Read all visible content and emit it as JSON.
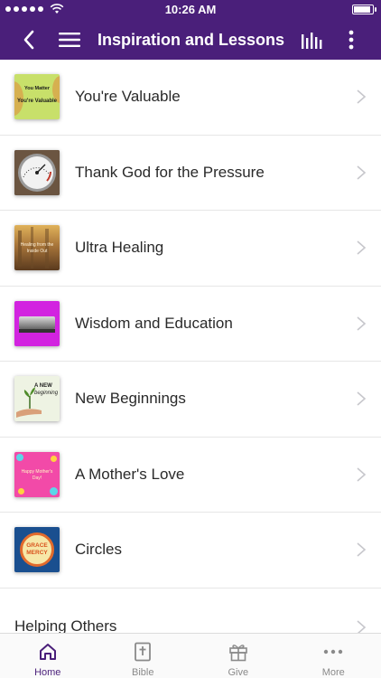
{
  "status": {
    "time": "10:26 AM",
    "battery_level": 0.95
  },
  "nav": {
    "title": "Inspiration and Lessons",
    "back_icon": "chevron-left-icon",
    "menu_icon": "hamburger-menu-icon",
    "audio_icon": "audio-bars-icon",
    "more_icon": "vertical-dots-icon"
  },
  "items": [
    {
      "title": "You're Valuable",
      "thumb_lines": [
        "You Matter",
        "You're Valuable"
      ]
    },
    {
      "title": "Thank God for the Pressure"
    },
    {
      "title": "Ultra Healing",
      "thumb_lines": [
        "Healing from the",
        "Inside Out"
      ]
    },
    {
      "title": "Wisdom and Education"
    },
    {
      "title": "New Beginnings",
      "thumb_lines": [
        "A NEW",
        "beginning"
      ]
    },
    {
      "title": "A Mother's Love",
      "thumb_lines": [
        "Happy Mother's",
        "Day!"
      ]
    },
    {
      "title": "Circles",
      "thumb_lines": [
        "GRACE",
        "MERCY"
      ]
    },
    {
      "title": "Helping Others"
    }
  ],
  "tabs": [
    {
      "label": "Home",
      "icon": "home-icon",
      "active": true
    },
    {
      "label": "Bible",
      "icon": "bible-icon",
      "active": false
    },
    {
      "label": "Give",
      "icon": "gift-icon",
      "active": false
    },
    {
      "label": "More",
      "icon": "more-dots-icon",
      "active": false
    }
  ],
  "colors": {
    "brand": "#4a1f7a",
    "chevron": "#c7c7cc"
  }
}
